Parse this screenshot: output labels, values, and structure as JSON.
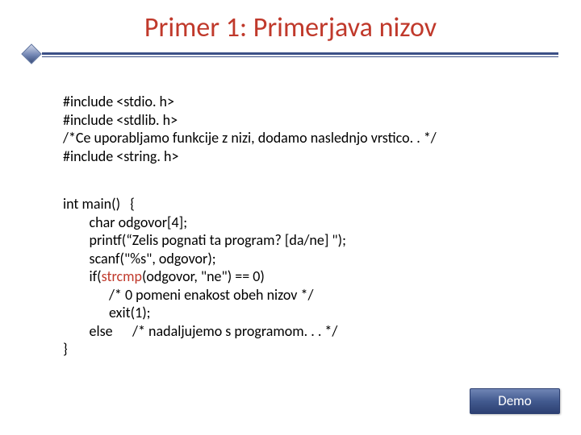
{
  "title": "Primer 1: Primerjava nizov",
  "code": {
    "includes": {
      "l1": "#include <stdio. h>",
      "l2": "#include <stdlib. h>",
      "l3": "/*Ce uporabljamo funkcije z nizi, dodamo naslednjo vrstico. . */",
      "l4": "#include <string. h>"
    },
    "main": {
      "l1": "int main()   {",
      "l2": "        char odgovor[4];",
      "l3": "        printf(“Zelis pognati ta program? [da/ne] \");",
      "l4": "        scanf(\"%s\", odgovor);",
      "l5a": "        if(",
      "l5b": "strcmp",
      "l5c": "(odgovor, \"ne\") == 0)",
      "l6": "              /* 0 pomeni enakost obeh nizov */",
      "l7": "              exit(1);",
      "l8": "        else      /* nadaljujemo s programom. . . */",
      "l9": "}"
    }
  },
  "demo_label": "Demo"
}
